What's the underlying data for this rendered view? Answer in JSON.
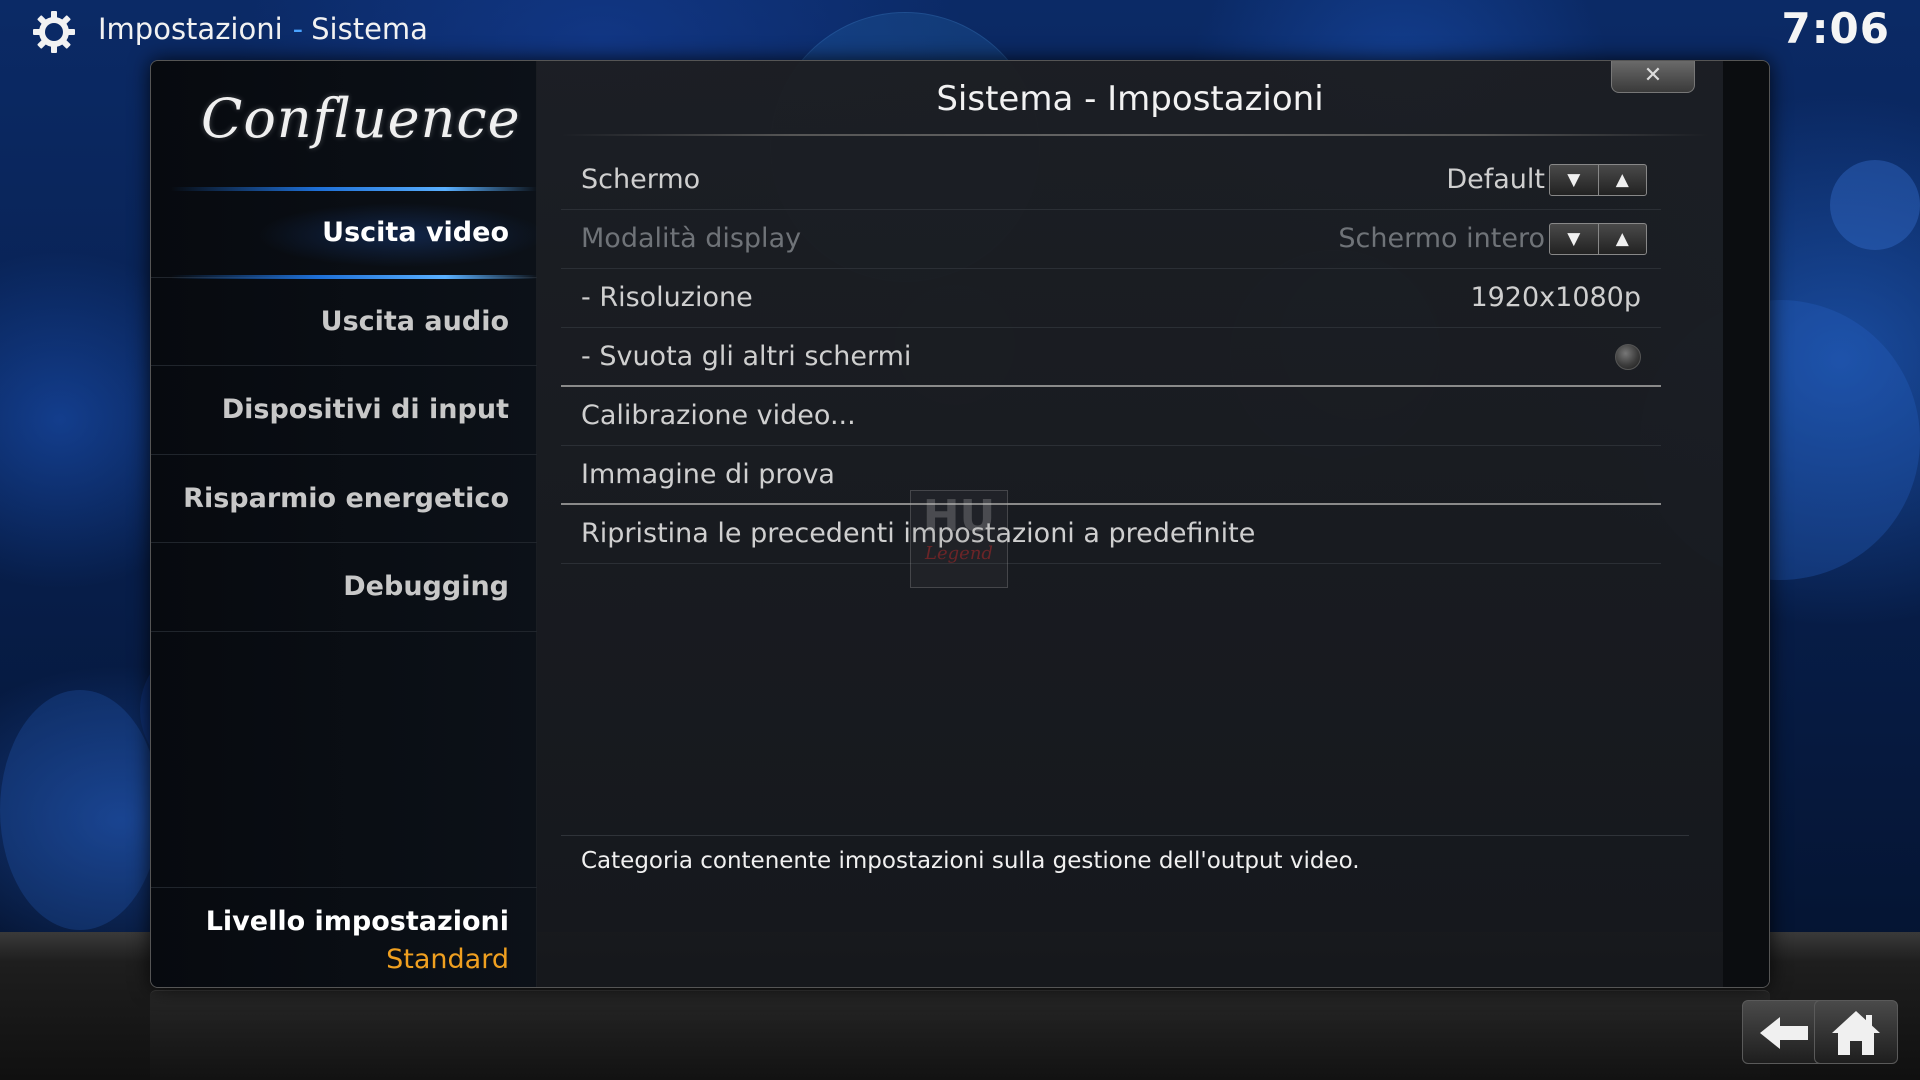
{
  "header": {
    "section": "Impostazioni",
    "separator": "-",
    "subsection": "Sistema",
    "clock": "7:06",
    "icon": "gear-icon"
  },
  "dialog": {
    "title": "Sistema - Impostazioni",
    "close_label": "✕",
    "logo_text": "Confluence"
  },
  "sidebar": {
    "items": [
      {
        "label": "Uscita video",
        "active": true
      },
      {
        "label": "Uscita audio",
        "active": false
      },
      {
        "label": "Dispositivi di input",
        "active": false
      },
      {
        "label": "Risparmio energetico",
        "active": false
      },
      {
        "label": "Debugging",
        "active": false
      }
    ],
    "level_label": "Livello impostazioni",
    "level_value": "Standard"
  },
  "settings": [
    {
      "label": "Schermo",
      "value": "Default",
      "control": "spinner",
      "enabled": true
    },
    {
      "label": "Modalità display",
      "value": "Schermo intero",
      "control": "spinner",
      "enabled": false
    },
    {
      "label": "- Risoluzione",
      "value": "1920x1080p",
      "control": "value",
      "enabled": true
    },
    {
      "label": "- Svuota gli altri schermi",
      "value": "",
      "control": "radio",
      "enabled": true
    },
    {
      "label": "Calibrazione video...",
      "value": "",
      "control": "none",
      "enabled": true
    },
    {
      "label": "Immagine di prova",
      "value": "",
      "control": "none",
      "enabled": true
    },
    {
      "label": "Ripristina le precedenti impostazioni a predefinite",
      "value": "",
      "control": "none",
      "enabled": true
    }
  ],
  "spinner": {
    "down": "▼",
    "up": "▲"
  },
  "description": "Categoria contenente impostazioni sulla gestione dell'output video.",
  "watermark": {
    "top": "HU",
    "bottom": "Legend"
  },
  "footer": {
    "back_icon": "back-arrow-icon",
    "home_icon": "home-icon"
  },
  "colors": {
    "accent_blue": "#4aa3ff",
    "level_orange": "#f0a020"
  }
}
